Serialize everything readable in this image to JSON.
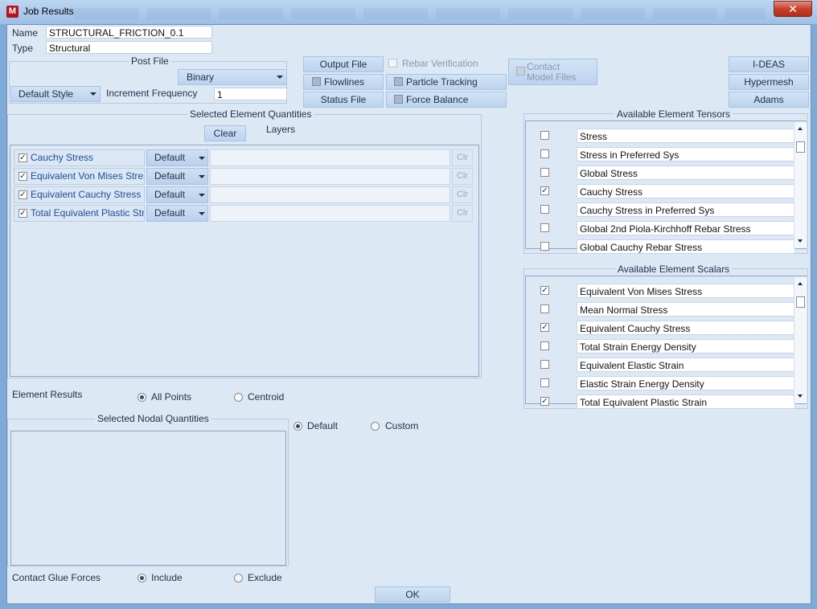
{
  "window": {
    "title": "Job Results",
    "app_icon": "M",
    "close_glyph": "✕"
  },
  "name_field": {
    "label": "Name",
    "value": "STRUCTURAL_FRICTION_0.1"
  },
  "type_field": {
    "label": "Type",
    "value": "Structural"
  },
  "post_file": {
    "title": "Post File",
    "format_value": "Binary",
    "style_value": "Default Style",
    "increment_label": "Increment Frequency",
    "increment_value": "1"
  },
  "buttons": {
    "output_file": "Output File",
    "flowlines": "Flowlines",
    "status_file": "Status File",
    "rebar_verification": "Rebar Verification",
    "particle_tracking": "Particle Tracking",
    "force_balance": "Force Balance",
    "contact_model_files_line1": "Contact",
    "contact_model_files_line2": "Model Files",
    "ideas": "I-DEAS",
    "hypermesh": "Hypermesh",
    "adams": "Adams",
    "ok": "OK"
  },
  "selected_element": {
    "title": "Selected Element Quantities",
    "clear_label": "Clear",
    "layers_label": "Layers",
    "rows": [
      {
        "name": "Cauchy Stress",
        "checked": "✓",
        "layer": "Default",
        "clr": "Clr"
      },
      {
        "name": "Equivalent Von Mises Stress",
        "checked": "✓",
        "layer": "Default",
        "clr": "Clr"
      },
      {
        "name": "Equivalent Cauchy Stress",
        "checked": "✓",
        "layer": "Default",
        "clr": "Clr"
      },
      {
        "name": "Total Equivalent Plastic Strain",
        "checked": "✓",
        "layer": "Default",
        "clr": "Clr"
      }
    ]
  },
  "element_results": {
    "label": "Element Results",
    "all_points": "All Points",
    "centroid": "Centroid",
    "selected": "all_points"
  },
  "selected_nodal": {
    "title": "Selected Nodal Quantities",
    "default_label": "Default",
    "custom_label": "Custom",
    "selected": "default"
  },
  "contact_glue": {
    "label": "Contact Glue Forces",
    "include": "Include",
    "exclude": "Exclude",
    "selected": "include"
  },
  "tensors": {
    "title": "Available Element Tensors",
    "items": [
      {
        "label": "Stress",
        "check": ""
      },
      {
        "label": "Stress in Preferred Sys",
        "check": ""
      },
      {
        "label": "Global Stress",
        "check": ""
      },
      {
        "label": "Cauchy Stress",
        "check": "✓"
      },
      {
        "label": "Cauchy Stress in Preferred Sys",
        "check": ""
      },
      {
        "label": "Global 2nd Piola-Kirchhoff Rebar Stress",
        "check": ""
      },
      {
        "label": "Global Cauchy Rebar Stress",
        "check": ""
      }
    ]
  },
  "scalars": {
    "title": "Available Element Scalars",
    "items": [
      {
        "label": "Equivalent Von Mises Stress",
        "check": "✓"
      },
      {
        "label": "Mean Normal Stress",
        "check": ""
      },
      {
        "label": "Equivalent Cauchy Stress",
        "check": "✓"
      },
      {
        "label": "Total Strain Energy Density",
        "check": ""
      },
      {
        "label": "Equivalent Elastic Strain",
        "check": ""
      },
      {
        "label": "Elastic Strain Energy Density",
        "check": ""
      },
      {
        "label": "Total Equivalent Plastic Strain",
        "check": "✓"
      }
    ]
  },
  "colors": {
    "client_bg": "#dde8f5",
    "button_bg": "#c6dbf2",
    "close_red": "#c6412a",
    "label_blue": "#1d4f91"
  }
}
